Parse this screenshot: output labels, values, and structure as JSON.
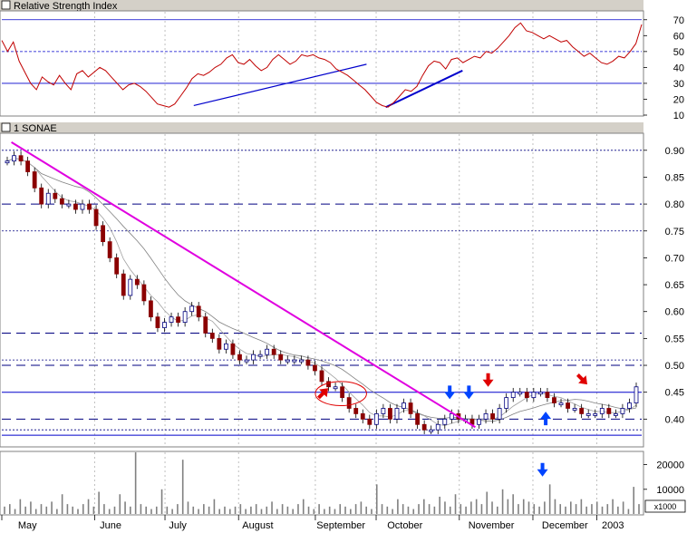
{
  "colors": {
    "background": "#ffffff",
    "title_bar": "#d4d0c8",
    "rsi_line": "#c00000",
    "trend_magenta": "#e000e0",
    "trend_blue": "#0000cc",
    "sma": "#808080",
    "bull_candle": "#ffffff",
    "bear_candle": "#8b0000",
    "guide_blue": "#0000cc",
    "arrow_red": "#e00000",
    "arrow_blue": "#0044ff",
    "volume_bar": "#808080",
    "grid": "#b0b0b0"
  },
  "chart_data": [
    {
      "panel": "rsi",
      "type": "line",
      "title": "Relative Strength Index",
      "ylim": [
        10,
        75
      ],
      "yticks": [
        "10",
        "20",
        "30",
        "40",
        "50",
        "60",
        "70"
      ],
      "reference_levels": [
        30,
        50,
        70
      ],
      "values": [
        57,
        50,
        56,
        44,
        37,
        30,
        26,
        34,
        31,
        29,
        35,
        30,
        26,
        36,
        38,
        34,
        37,
        40,
        38,
        34,
        30,
        26,
        29,
        30,
        28,
        25,
        21,
        17,
        16,
        15,
        17,
        22,
        27,
        33,
        36,
        35,
        37,
        40,
        42,
        46,
        48,
        43,
        42,
        45,
        41,
        38,
        40,
        45,
        48,
        45,
        42,
        44,
        48,
        47,
        48,
        46,
        45,
        43,
        39,
        37,
        35,
        32,
        29,
        26,
        22,
        18,
        16,
        15,
        18,
        22,
        26,
        25,
        28,
        35,
        41,
        44,
        43,
        39,
        45,
        46,
        43,
        45,
        47,
        46,
        50,
        49,
        52,
        56,
        60,
        65,
        68,
        63,
        62,
        60,
        58,
        60,
        58,
        56,
        57,
        53,
        50,
        47,
        49,
        46,
        43,
        42,
        44,
        47,
        46,
        50,
        55,
        67
      ],
      "trendlines": [
        {
          "from": [
            0.3,
            16
          ],
          "to": [
            0.57,
            42
          ]
        },
        {
          "from": [
            0.6,
            15
          ],
          "to": [
            0.72,
            38
          ]
        }
      ]
    },
    {
      "panel": "price",
      "type": "candlestick",
      "title": "1 SONAE",
      "ylim": [
        0.35,
        0.93
      ],
      "yticks": [
        "0.40",
        "0.45",
        "0.50",
        "0.55",
        "0.60",
        "0.65",
        "0.70",
        "0.75",
        "0.80",
        "0.85",
        "0.90"
      ],
      "dashed_levels": [
        0.8,
        0.56,
        0.5,
        0.4
      ],
      "dotted_levels": [
        0.9,
        0.75,
        0.51,
        0.38
      ],
      "solid_levels": [
        0.45,
        0.37
      ],
      "closes": [
        0.88,
        0.89,
        0.88,
        0.86,
        0.83,
        0.8,
        0.82,
        0.81,
        0.8,
        0.8,
        0.79,
        0.8,
        0.79,
        0.76,
        0.73,
        0.7,
        0.67,
        0.63,
        0.66,
        0.65,
        0.62,
        0.59,
        0.57,
        0.58,
        0.59,
        0.58,
        0.6,
        0.61,
        0.59,
        0.56,
        0.55,
        0.53,
        0.54,
        0.52,
        0.51,
        0.51,
        0.52,
        0.52,
        0.53,
        0.52,
        0.51,
        0.51,
        0.51,
        0.51,
        0.5,
        0.49,
        0.47,
        0.46,
        0.46,
        0.44,
        0.42,
        0.41,
        0.4,
        0.39,
        0.41,
        0.42,
        0.4,
        0.42,
        0.43,
        0.41,
        0.39,
        0.38,
        0.38,
        0.39,
        0.4,
        0.41,
        0.4,
        0.4,
        0.39,
        0.4,
        0.41,
        0.4,
        0.42,
        0.44,
        0.45,
        0.45,
        0.44,
        0.45,
        0.45,
        0.44,
        0.43,
        0.43,
        0.42,
        0.42,
        0.41,
        0.41,
        0.41,
        0.42,
        0.41,
        0.41,
        0.42,
        0.43,
        0.46
      ],
      "trendline": {
        "from": [
          0.015,
          0.915
        ],
        "to": [
          0.74,
          0.385
        ]
      },
      "ellipse": {
        "x": [
          0.49,
          0.57
        ],
        "y": [
          0.425,
          0.47
        ]
      },
      "arrows": [
        {
          "color": "red",
          "dir": "up-right",
          "at": [
            0.505,
            0.438
          ]
        },
        {
          "color": "red",
          "dir": "down",
          "at": [
            0.76,
            0.455
          ]
        },
        {
          "color": "red",
          "dir": "down-right",
          "at": [
            0.91,
            0.457
          ]
        },
        {
          "color": "blue",
          "dir": "down",
          "at": [
            0.7,
            0.432
          ]
        },
        {
          "color": "blue",
          "dir": "down",
          "at": [
            0.73,
            0.432
          ]
        },
        {
          "color": "blue",
          "dir": "up",
          "at": [
            0.85,
            0.392
          ]
        }
      ]
    },
    {
      "panel": "volume",
      "type": "bar",
      "ylim": [
        0,
        25000
      ],
      "yticks": [
        "10000",
        "20000"
      ],
      "unit": "x1000",
      "values": [
        3000,
        4000,
        2000,
        6000,
        3000,
        5000,
        2000,
        4000,
        3000,
        5000,
        2000,
        8000,
        4000,
        3000,
        2000,
        4000,
        6000,
        3000,
        9000,
        4000,
        2000,
        3000,
        8000,
        5000,
        3000,
        25000,
        4000,
        3000,
        2000,
        3000,
        10000,
        3000,
        2000,
        4000,
        22000,
        5000,
        3000,
        2000,
        4000,
        3000,
        6000,
        2000,
        3000,
        2000,
        3000,
        4000,
        2000,
        3000,
        4000,
        2000,
        3000,
        5000,
        2000,
        4000,
        3000,
        2000,
        4000,
        6000,
        3000,
        2000,
        4000,
        2000,
        3000,
        2000,
        4000,
        3000,
        2000,
        4000,
        5000,
        3000,
        2000,
        12000,
        4000,
        3000,
        2000,
        6000,
        4000,
        3000,
        2000,
        4000,
        6000,
        4000,
        3000,
        7000,
        5000,
        3000,
        8000,
        4000,
        3000,
        5000,
        6000,
        4000,
        9000,
        5000,
        3000,
        10000,
        6000,
        8000,
        4000,
        6000,
        5000,
        4000,
        3000,
        5000,
        12000,
        6000,
        4000,
        3000,
        5000,
        4000,
        6000,
        3000,
        4000,
        5000,
        3000,
        4000,
        6000,
        3000,
        5000,
        2000,
        11000,
        4000
      ],
      "arrow": {
        "color": "blue",
        "dir": "down",
        "at": [
          0.845,
          17000
        ]
      }
    }
  ],
  "months": [
    "May",
    "June",
    "July",
    "August",
    "September",
    "October",
    "November",
    "December",
    "2003"
  ]
}
